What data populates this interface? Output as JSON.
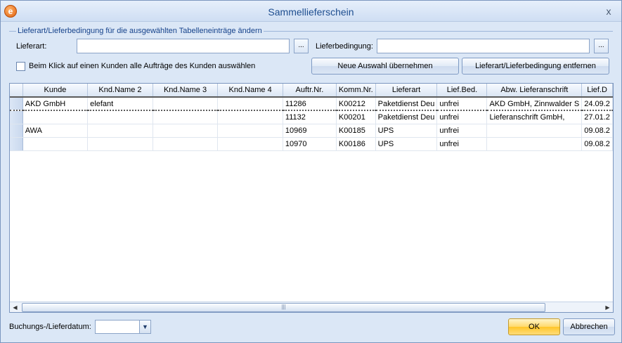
{
  "window": {
    "title": "Sammellieferschein",
    "close_glyph": "x",
    "app_icon_glyph": "e"
  },
  "group": {
    "title": "Lieferart/Lieferbedingung für die ausgewählten Tabelleneinträge ändern"
  },
  "form": {
    "lieferart_label": "Lieferart:",
    "lieferart_value": "",
    "lieferbedingung_label": "Lieferbedingung:",
    "lieferbedingung_value": "",
    "browse_label": "...",
    "checkbox_label": "Beim Klick auf einen Kunden alle Aufträge des Kunden auswählen",
    "checkbox_checked": false
  },
  "buttons": {
    "neue_auswahl": "Neue Auswahl übernehmen",
    "entfernen": "Lieferart/Lieferbedingung entfernen",
    "ok": "OK",
    "abbrechen": "Abbrechen"
  },
  "table": {
    "columns": [
      "Kunde",
      "Knd.Name 2",
      "Knd.Name 3",
      "Knd.Name 4",
      "Auftr.Nr.",
      "Komm.Nr.",
      "Lieferart",
      "Lief.Bed.",
      "Abw. Lieferanschrift",
      "Lief.D"
    ],
    "rows": [
      [
        "AKD GmbH",
        "elefant",
        "",
        "",
        "11286",
        "K00212",
        "Paketdienst Deu",
        "unfrei",
        "AKD GmbH, Zinnwalder S",
        "24.09.2"
      ],
      [
        "",
        "",
        "",
        "",
        "11132",
        "K00201",
        "Paketdienst Deu",
        "unfrei",
        "Lieferanschrift GmbH,",
        "27.01.2"
      ],
      [
        "AWA",
        "",
        "",
        "",
        "10969",
        "K00185",
        "UPS",
        "unfrei",
        "",
        "09.08.2"
      ],
      [
        "",
        "",
        "",
        "",
        "10970",
        "K00186",
        "UPS",
        "unfrei",
        "",
        "09.08.2"
      ]
    ],
    "selected_row": 0
  },
  "footer": {
    "date_label": "Buchungs-/Lieferdatum:",
    "date_value": ""
  },
  "colors": {
    "accent": "#1e4e90",
    "background": "#dbe7f6",
    "ok_button": "#ffc629"
  }
}
